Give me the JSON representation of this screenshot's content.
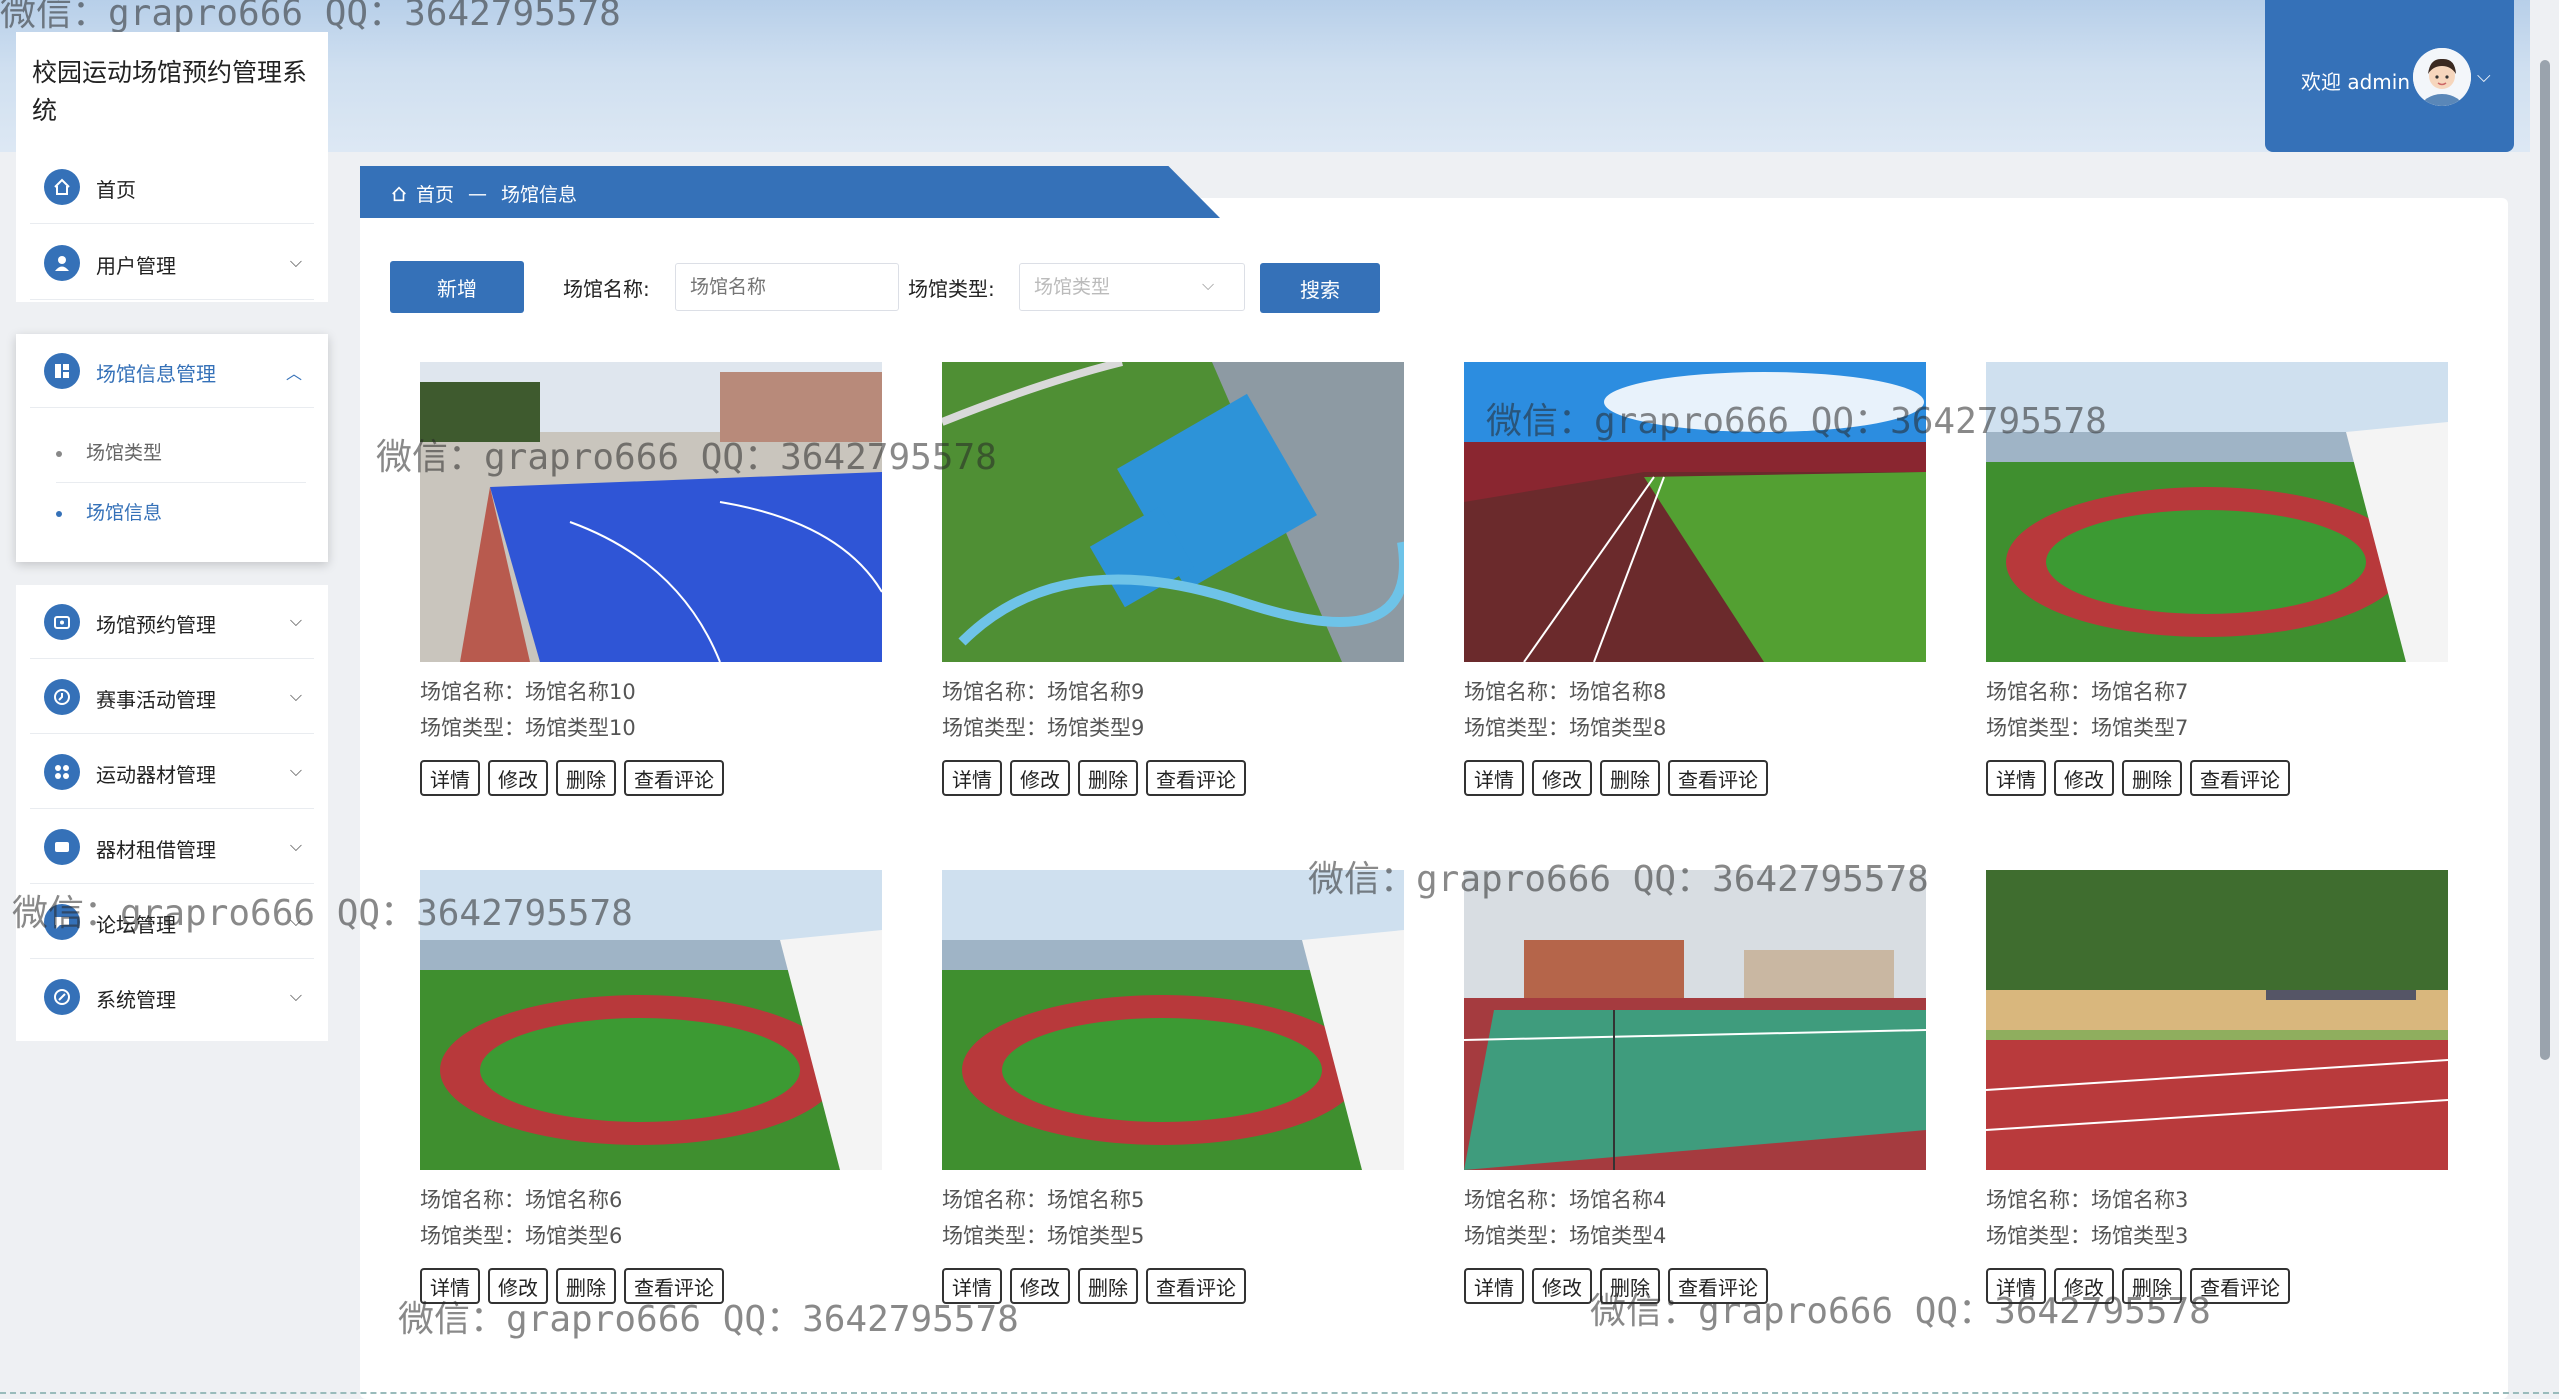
{
  "header": {
    "app_title": "校园运动场馆预约管理系统",
    "welcome": "欢迎 admin",
    "caret": "⌵"
  },
  "sidebar": {
    "items": [
      {
        "label": "首页",
        "icon": "home-icon"
      },
      {
        "label": "用户管理",
        "icon": "user-icon"
      },
      {
        "label": "场馆信息管理",
        "icon": "grid-icon",
        "expanded": true
      },
      {
        "label": "场馆预约管理",
        "icon": "calendar-icon"
      },
      {
        "label": "赛事活动管理",
        "icon": "clock-icon"
      },
      {
        "label": "运动器材管理",
        "icon": "apps-icon"
      },
      {
        "label": "器材租借管理",
        "icon": "card-icon"
      },
      {
        "label": "论坛管理",
        "icon": "chat-icon"
      },
      {
        "label": "系统管理",
        "icon": "settings-icon"
      }
    ],
    "subitems": [
      {
        "label": "场馆类型",
        "active": false
      },
      {
        "label": "场馆信息",
        "active": true
      }
    ],
    "chevron_down": "⌵",
    "chevron_up": "︿"
  },
  "breadcrumb": {
    "home": "首页",
    "separator": "—",
    "current": "场馆信息"
  },
  "toolbar": {
    "add_label": "新增",
    "name_label": "场馆名称:",
    "name_placeholder": "场馆名称",
    "type_label": "场馆类型:",
    "type_placeholder": "场馆类型",
    "search_label": "搜索"
  },
  "card_actions": {
    "detail": "详情",
    "edit": "修改",
    "delete": "删除",
    "reviews": "查看评论"
  },
  "venues": [
    {
      "name_line": "场馆名称：场馆名称10",
      "type_line": "场馆类型：场馆类型10",
      "scene": "basketball-court"
    },
    {
      "name_line": "场馆名称：场馆名称9",
      "type_line": "场馆类型：场馆类型9",
      "scene": "aerial-courts"
    },
    {
      "name_line": "场馆名称：场馆名称8",
      "type_line": "场馆类型：场馆类型8",
      "scene": "stadium-track"
    },
    {
      "name_line": "场馆名称：场馆名称7",
      "type_line": "场馆类型：场馆类型7",
      "scene": "running-track"
    },
    {
      "name_line": "场馆名称：场馆名称6",
      "type_line": "场馆类型：场馆类型6",
      "scene": "running-track"
    },
    {
      "name_line": "场馆名称：场馆名称5",
      "type_line": "场馆类型：场馆类型5",
      "scene": "running-track"
    },
    {
      "name_line": "场馆名称：场馆名称4",
      "type_line": "场馆类型：场馆类型4",
      "scene": "tennis-court"
    },
    {
      "name_line": "场馆名称：场馆名称3",
      "type_line": "场馆类型：场馆类型3",
      "scene": "fenced-track"
    }
  ],
  "watermark": "微信：grapro666 QQ：3642795578",
  "colors": {
    "accent": "#3571b8"
  }
}
